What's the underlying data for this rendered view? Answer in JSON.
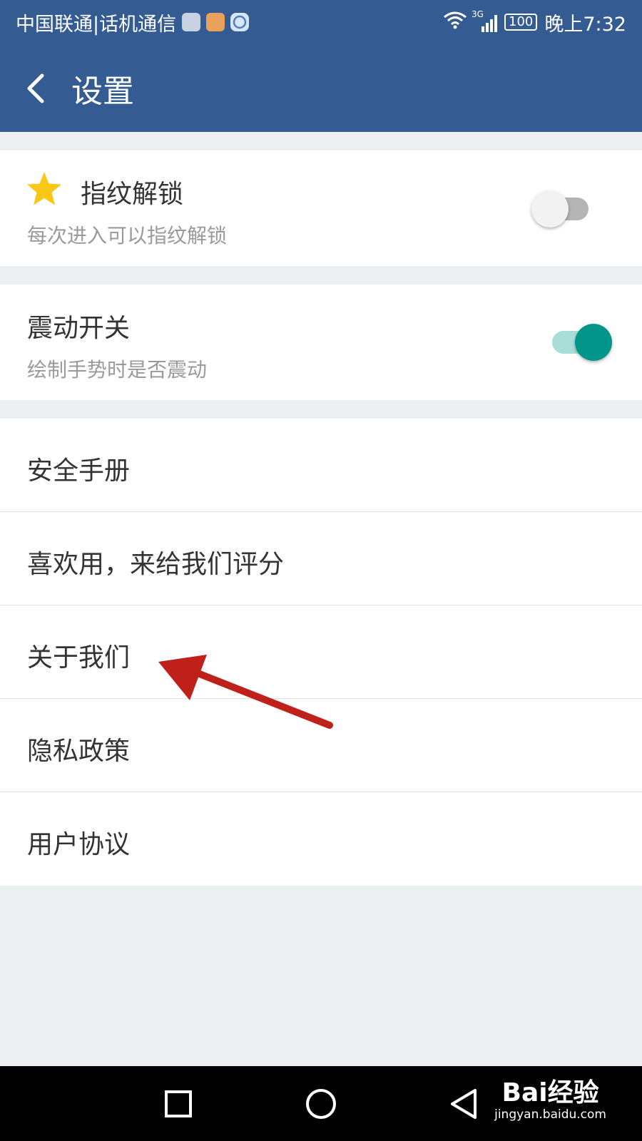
{
  "status_bar": {
    "carrier": "中国联通|话机通信",
    "network": "3G",
    "battery": "100",
    "time": "晚上7:32"
  },
  "app_bar": {
    "title": "设置"
  },
  "settings": {
    "fingerprint": {
      "title": "指纹解锁",
      "subtitle": "每次进入可以指纹解锁",
      "enabled": false
    },
    "vibration": {
      "title": "震动开关",
      "subtitle": "绘制手势时是否震动",
      "enabled": true
    }
  },
  "menu": {
    "items": [
      {
        "label": "安全手册"
      },
      {
        "label": "喜欢用，来给我们评分"
      },
      {
        "label": "关于我们"
      },
      {
        "label": "隐私政策"
      },
      {
        "label": "用户协议"
      }
    ]
  },
  "watermark": {
    "logo": "Bai经验",
    "url": "jingyan.baidu.com"
  },
  "colors": {
    "primary": "#355c92",
    "accent": "#00968a",
    "annotation": "#c0201a",
    "star": "#f9c817"
  }
}
